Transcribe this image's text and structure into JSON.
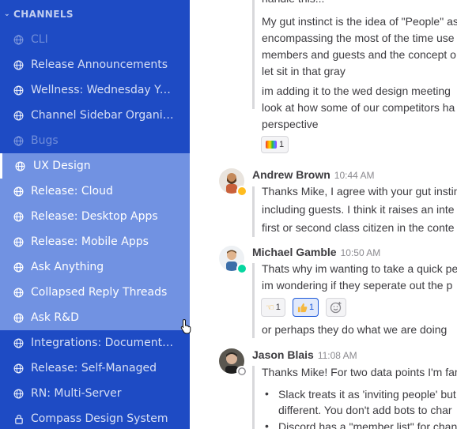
{
  "sidebar": {
    "section_title": "CHANNELS",
    "channels": [
      {
        "label": "CLI",
        "icon": "globe-icon"
      },
      {
        "label": "Release Announcements",
        "icon": "globe-icon"
      },
      {
        "label": "Wellness: Wednesday Yoga",
        "icon": "globe-icon"
      },
      {
        "label": "Channel Sidebar Organizati...",
        "icon": "globe-icon"
      },
      {
        "label": "Bugs",
        "icon": "globe-icon"
      },
      {
        "label": "UX Design",
        "icon": "globe-icon"
      },
      {
        "label": "Release: Cloud",
        "icon": "globe-icon"
      },
      {
        "label": "Release: Desktop Apps",
        "icon": "globe-icon"
      },
      {
        "label": "Release: Mobile Apps",
        "icon": "globe-icon"
      },
      {
        "label": "Ask Anything",
        "icon": "globe-icon"
      },
      {
        "label": "Collapsed Reply Threads",
        "icon": "globe-icon"
      },
      {
        "label": "Ask R&D",
        "icon": "globe-icon"
      },
      {
        "label": "Integrations: Documentati...",
        "icon": "globe-icon"
      },
      {
        "label": "Release: Self-Managed",
        "icon": "globe-icon"
      },
      {
        "label": "RN: Multi-Server",
        "icon": "globe-icon"
      },
      {
        "label": "Compass Design System",
        "icon": "lock-icon"
      }
    ]
  },
  "posts": {
    "p0": {
      "lines": [
        "handle this...",
        "My gut instinct is the idea of \"People\" as",
        "encompassing the most of the time use",
        "members and guests and the concept o",
        "let sit in that gray"
      ],
      "lines2": [
        "im adding it to the wed design meeting",
        "look at how some of our competitors ha",
        "perspective"
      ],
      "reaction": {
        "count": "1",
        "emoji": "rainbow-icon"
      }
    },
    "p1": {
      "author": "Andrew Brown",
      "time": "10:44 AM",
      "lines": [
        "Thanks Mike, I agree with your gut instin",
        "including guests. I think it raises an inte",
        "first or second class citizen in the conte"
      ]
    },
    "p2": {
      "author": "Michael Gamble",
      "time": "10:50 AM",
      "lines": [
        "Thats why im wanting to take a quick pe",
        "im wondering if they seperate out the p"
      ],
      "reactions": [
        {
          "emoji": "point-left-icon",
          "count": "1"
        },
        {
          "emoji": "thumbs-up-icon",
          "count": "1"
        }
      ],
      "followup": "or perhaps they do what we are doing"
    },
    "p3": {
      "author": "Jason Blais",
      "time": "11:08 AM",
      "lines": [
        "Thanks Mike! For two data points I'm fam"
      ],
      "bullets": [
        {
          "line1": "Slack treats it as 'inviting people' but",
          "line2": "different. You don't add bots to char"
        },
        {
          "line1": "Discord has a \"member list\" for chann",
          "line2": ""
        }
      ]
    }
  },
  "colors": {
    "sidebar_bg": "#1e4bc4",
    "sidebar_highlight": "#7192e2",
    "online": "#06d6a0",
    "away": "#ffbc1f",
    "accent": "#1c58d9"
  }
}
